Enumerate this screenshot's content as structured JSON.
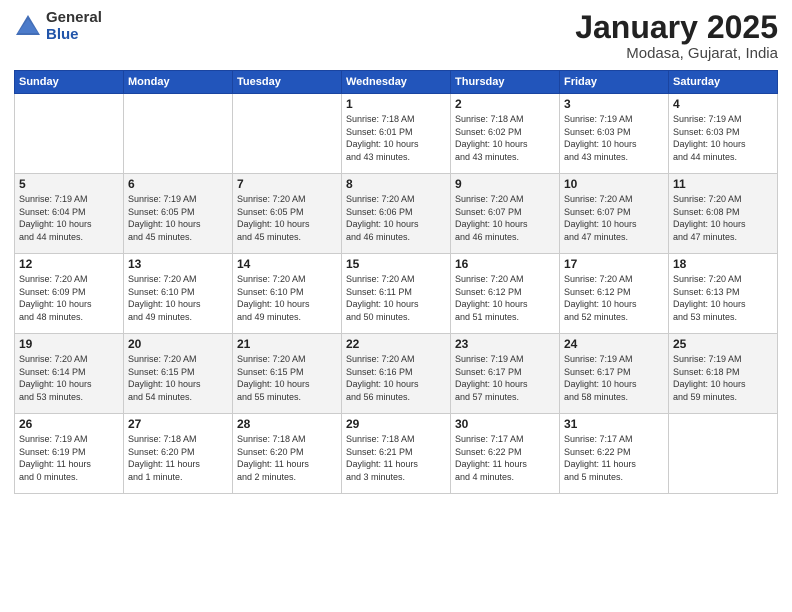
{
  "logo": {
    "general": "General",
    "blue": "Blue"
  },
  "title": "January 2025",
  "subtitle": "Modasa, Gujarat, India",
  "days_of_week": [
    "Sunday",
    "Monday",
    "Tuesday",
    "Wednesday",
    "Thursday",
    "Friday",
    "Saturday"
  ],
  "weeks": [
    [
      {
        "day": "",
        "info": ""
      },
      {
        "day": "",
        "info": ""
      },
      {
        "day": "",
        "info": ""
      },
      {
        "day": "1",
        "info": "Sunrise: 7:18 AM\nSunset: 6:01 PM\nDaylight: 10 hours\nand 43 minutes."
      },
      {
        "day": "2",
        "info": "Sunrise: 7:18 AM\nSunset: 6:02 PM\nDaylight: 10 hours\nand 43 minutes."
      },
      {
        "day": "3",
        "info": "Sunrise: 7:19 AM\nSunset: 6:03 PM\nDaylight: 10 hours\nand 43 minutes."
      },
      {
        "day": "4",
        "info": "Sunrise: 7:19 AM\nSunset: 6:03 PM\nDaylight: 10 hours\nand 44 minutes."
      }
    ],
    [
      {
        "day": "5",
        "info": "Sunrise: 7:19 AM\nSunset: 6:04 PM\nDaylight: 10 hours\nand 44 minutes."
      },
      {
        "day": "6",
        "info": "Sunrise: 7:19 AM\nSunset: 6:05 PM\nDaylight: 10 hours\nand 45 minutes."
      },
      {
        "day": "7",
        "info": "Sunrise: 7:20 AM\nSunset: 6:05 PM\nDaylight: 10 hours\nand 45 minutes."
      },
      {
        "day": "8",
        "info": "Sunrise: 7:20 AM\nSunset: 6:06 PM\nDaylight: 10 hours\nand 46 minutes."
      },
      {
        "day": "9",
        "info": "Sunrise: 7:20 AM\nSunset: 6:07 PM\nDaylight: 10 hours\nand 46 minutes."
      },
      {
        "day": "10",
        "info": "Sunrise: 7:20 AM\nSunset: 6:07 PM\nDaylight: 10 hours\nand 47 minutes."
      },
      {
        "day": "11",
        "info": "Sunrise: 7:20 AM\nSunset: 6:08 PM\nDaylight: 10 hours\nand 47 minutes."
      }
    ],
    [
      {
        "day": "12",
        "info": "Sunrise: 7:20 AM\nSunset: 6:09 PM\nDaylight: 10 hours\nand 48 minutes."
      },
      {
        "day": "13",
        "info": "Sunrise: 7:20 AM\nSunset: 6:10 PM\nDaylight: 10 hours\nand 49 minutes."
      },
      {
        "day": "14",
        "info": "Sunrise: 7:20 AM\nSunset: 6:10 PM\nDaylight: 10 hours\nand 49 minutes."
      },
      {
        "day": "15",
        "info": "Sunrise: 7:20 AM\nSunset: 6:11 PM\nDaylight: 10 hours\nand 50 minutes."
      },
      {
        "day": "16",
        "info": "Sunrise: 7:20 AM\nSunset: 6:12 PM\nDaylight: 10 hours\nand 51 minutes."
      },
      {
        "day": "17",
        "info": "Sunrise: 7:20 AM\nSunset: 6:12 PM\nDaylight: 10 hours\nand 52 minutes."
      },
      {
        "day": "18",
        "info": "Sunrise: 7:20 AM\nSunset: 6:13 PM\nDaylight: 10 hours\nand 53 minutes."
      }
    ],
    [
      {
        "day": "19",
        "info": "Sunrise: 7:20 AM\nSunset: 6:14 PM\nDaylight: 10 hours\nand 53 minutes."
      },
      {
        "day": "20",
        "info": "Sunrise: 7:20 AM\nSunset: 6:15 PM\nDaylight: 10 hours\nand 54 minutes."
      },
      {
        "day": "21",
        "info": "Sunrise: 7:20 AM\nSunset: 6:15 PM\nDaylight: 10 hours\nand 55 minutes."
      },
      {
        "day": "22",
        "info": "Sunrise: 7:20 AM\nSunset: 6:16 PM\nDaylight: 10 hours\nand 56 minutes."
      },
      {
        "day": "23",
        "info": "Sunrise: 7:19 AM\nSunset: 6:17 PM\nDaylight: 10 hours\nand 57 minutes."
      },
      {
        "day": "24",
        "info": "Sunrise: 7:19 AM\nSunset: 6:17 PM\nDaylight: 10 hours\nand 58 minutes."
      },
      {
        "day": "25",
        "info": "Sunrise: 7:19 AM\nSunset: 6:18 PM\nDaylight: 10 hours\nand 59 minutes."
      }
    ],
    [
      {
        "day": "26",
        "info": "Sunrise: 7:19 AM\nSunset: 6:19 PM\nDaylight: 11 hours\nand 0 minutes."
      },
      {
        "day": "27",
        "info": "Sunrise: 7:18 AM\nSunset: 6:20 PM\nDaylight: 11 hours\nand 1 minute."
      },
      {
        "day": "28",
        "info": "Sunrise: 7:18 AM\nSunset: 6:20 PM\nDaylight: 11 hours\nand 2 minutes."
      },
      {
        "day": "29",
        "info": "Sunrise: 7:18 AM\nSunset: 6:21 PM\nDaylight: 11 hours\nand 3 minutes."
      },
      {
        "day": "30",
        "info": "Sunrise: 7:17 AM\nSunset: 6:22 PM\nDaylight: 11 hours\nand 4 minutes."
      },
      {
        "day": "31",
        "info": "Sunrise: 7:17 AM\nSunset: 6:22 PM\nDaylight: 11 hours\nand 5 minutes."
      },
      {
        "day": "",
        "info": ""
      }
    ]
  ]
}
